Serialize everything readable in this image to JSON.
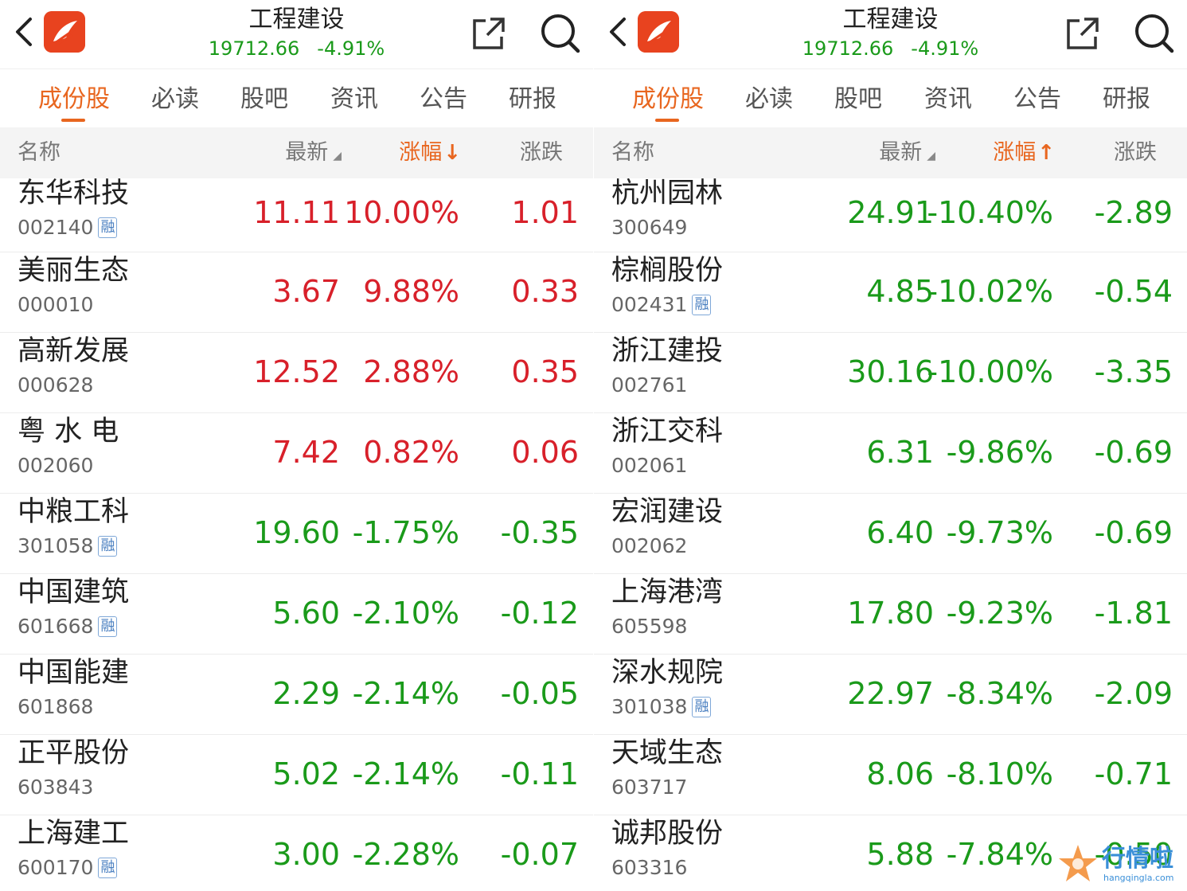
{
  "colors": {
    "accent": "#e8661f",
    "brand": "#e8431f",
    "up": "#d8202a",
    "down": "#1a9a1a",
    "margin_badge": "#4a7fc0"
  },
  "panels": [
    {
      "header": {
        "title": "工程建设",
        "index_value": "19712.66",
        "index_change": "-4.91%"
      },
      "tabs": [
        {
          "label": "成份股",
          "active": true
        },
        {
          "label": "必读"
        },
        {
          "label": "股吧"
        },
        {
          "label": "资讯"
        },
        {
          "label": "公告"
        },
        {
          "label": "研报"
        }
      ],
      "columns": {
        "name": "名称",
        "latest": "最新",
        "change": "涨幅",
        "change_sort": "↓",
        "diff": "涨跌"
      },
      "stocks": [
        {
          "name": "东华科技",
          "code": "002140",
          "badge": "融",
          "latest": "11.11",
          "change": "10.00%",
          "diff": "1.01",
          "trend": "up"
        },
        {
          "name": "美丽生态",
          "code": "000010",
          "badge": "",
          "latest": "3.67",
          "change": "9.88%",
          "diff": "0.33",
          "trend": "up"
        },
        {
          "name": "高新发展",
          "code": "000628",
          "badge": "",
          "latest": "12.52",
          "change": "2.88%",
          "diff": "0.35",
          "trend": "up"
        },
        {
          "name": "粤 水 电",
          "code": "002060",
          "badge": "",
          "latest": "7.42",
          "change": "0.82%",
          "diff": "0.06",
          "trend": "up"
        },
        {
          "name": "中粮工科",
          "code": "301058",
          "badge": "融",
          "latest": "19.60",
          "change": "-1.75%",
          "diff": "-0.35",
          "trend": "down"
        },
        {
          "name": "中国建筑",
          "code": "601668",
          "badge": "融",
          "latest": "5.60",
          "change": "-2.10%",
          "diff": "-0.12",
          "trend": "down"
        },
        {
          "name": "中国能建",
          "code": "601868",
          "badge": "",
          "latest": "2.29",
          "change": "-2.14%",
          "diff": "-0.05",
          "trend": "down"
        },
        {
          "name": "正平股份",
          "code": "603843",
          "badge": "",
          "latest": "5.02",
          "change": "-2.14%",
          "diff": "-0.11",
          "trend": "down"
        },
        {
          "name": "上海建工",
          "code": "600170",
          "badge": "融",
          "latest": "3.00",
          "change": "-2.28%",
          "diff": "-0.07",
          "trend": "down"
        }
      ]
    },
    {
      "header": {
        "title": "工程建设",
        "index_value": "19712.66",
        "index_change": "-4.91%"
      },
      "tabs": [
        {
          "label": "成份股",
          "active": true
        },
        {
          "label": "必读"
        },
        {
          "label": "股吧"
        },
        {
          "label": "资讯"
        },
        {
          "label": "公告"
        },
        {
          "label": "研报"
        }
      ],
      "columns": {
        "name": "名称",
        "latest": "最新",
        "change": "涨幅",
        "change_sort": "↑",
        "diff": "涨跌"
      },
      "stocks": [
        {
          "name": "杭州园林",
          "code": "300649",
          "badge": "",
          "latest": "24.91",
          "change": "-10.40%",
          "diff": "-2.89",
          "trend": "down"
        },
        {
          "name": "棕榈股份",
          "code": "002431",
          "badge": "融",
          "latest": "4.85",
          "change": "-10.02%",
          "diff": "-0.54",
          "trend": "down"
        },
        {
          "name": "浙江建投",
          "code": "002761",
          "badge": "",
          "latest": "30.16",
          "change": "-10.00%",
          "diff": "-3.35",
          "trend": "down"
        },
        {
          "name": "浙江交科",
          "code": "002061",
          "badge": "",
          "latest": "6.31",
          "change": "-9.86%",
          "diff": "-0.69",
          "trend": "down"
        },
        {
          "name": "宏润建设",
          "code": "002062",
          "badge": "",
          "latest": "6.40",
          "change": "-9.73%",
          "diff": "-0.69",
          "trend": "down"
        },
        {
          "name": "上海港湾",
          "code": "605598",
          "badge": "",
          "latest": "17.80",
          "change": "-9.23%",
          "diff": "-1.81",
          "trend": "down"
        },
        {
          "name": "深水规院",
          "code": "301038",
          "badge": "融",
          "latest": "22.97",
          "change": "-8.34%",
          "diff": "-2.09",
          "trend": "down"
        },
        {
          "name": "天域生态",
          "code": "603717",
          "badge": "",
          "latest": "8.06",
          "change": "-8.10%",
          "diff": "-0.71",
          "trend": "down"
        },
        {
          "name": "诚邦股份",
          "code": "603316",
          "badge": "",
          "latest": "5.88",
          "change": "-7.84%",
          "diff": "-0.50",
          "trend": "down"
        }
      ]
    }
  ],
  "watermark": {
    "text": "行情啦",
    "url": "hangqingla.com"
  }
}
